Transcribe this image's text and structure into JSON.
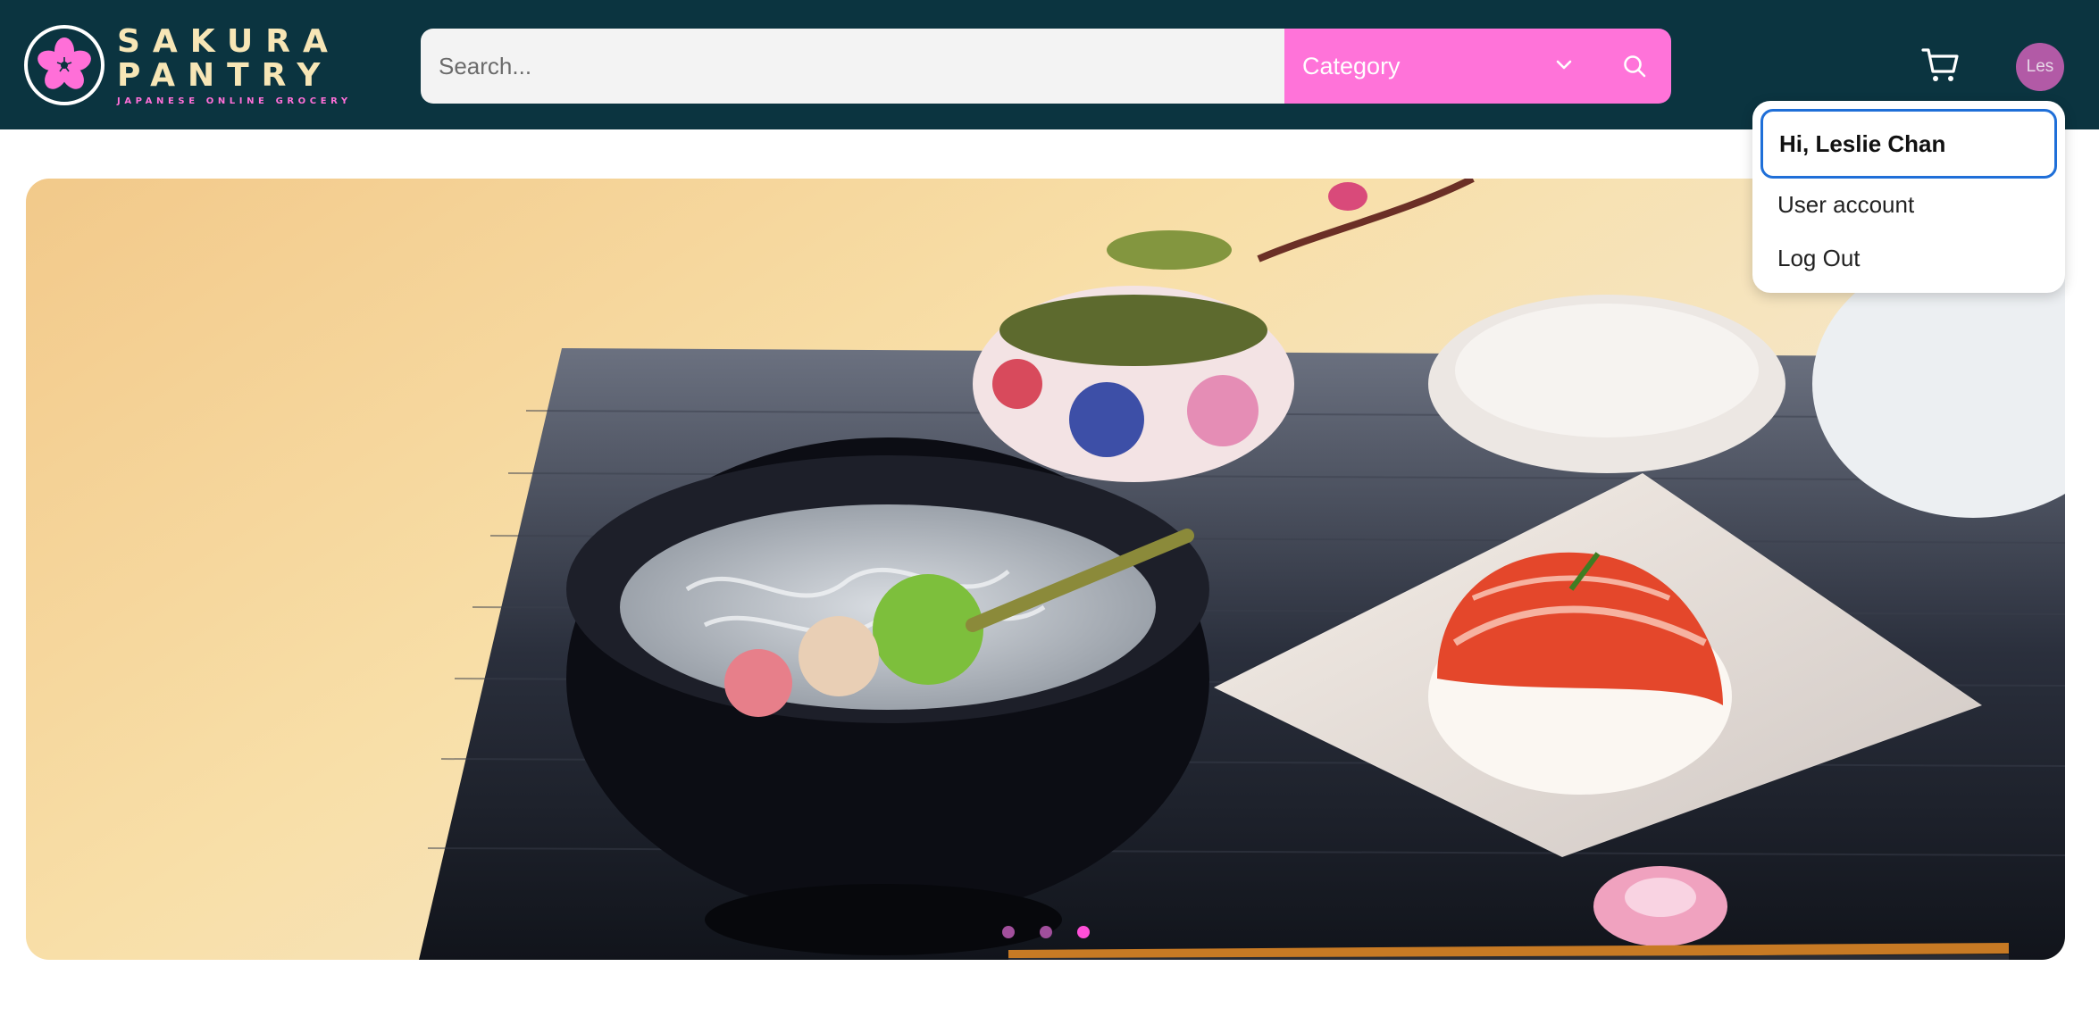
{
  "brand": {
    "line1": "SAKURA",
    "line2": "PANTRY",
    "tagline": "JAPANESE ONLINE GROCERY",
    "accent_color": "#ff6fd8",
    "logo_text_color": "#f7e6b6",
    "header_color": "#0b3440"
  },
  "search": {
    "placeholder": "Search...",
    "category_label": "Category",
    "category_color": "#ff73d9"
  },
  "icons": {
    "cart": "cart-icon",
    "search": "search-icon",
    "chevron": "chevron-down-icon",
    "logo": "sakura-flower-icon"
  },
  "user": {
    "avatar_label": "Les",
    "avatar_color": "#b25aa6"
  },
  "user_menu": {
    "greeting": "Hi, Leslie Chan",
    "items": [
      "User account",
      "Log Out"
    ]
  },
  "hero": {
    "slide_count": 3,
    "active_slide": 3,
    "dot_color": "#a14f9c",
    "active_dot_color": "#ff4fd8"
  }
}
